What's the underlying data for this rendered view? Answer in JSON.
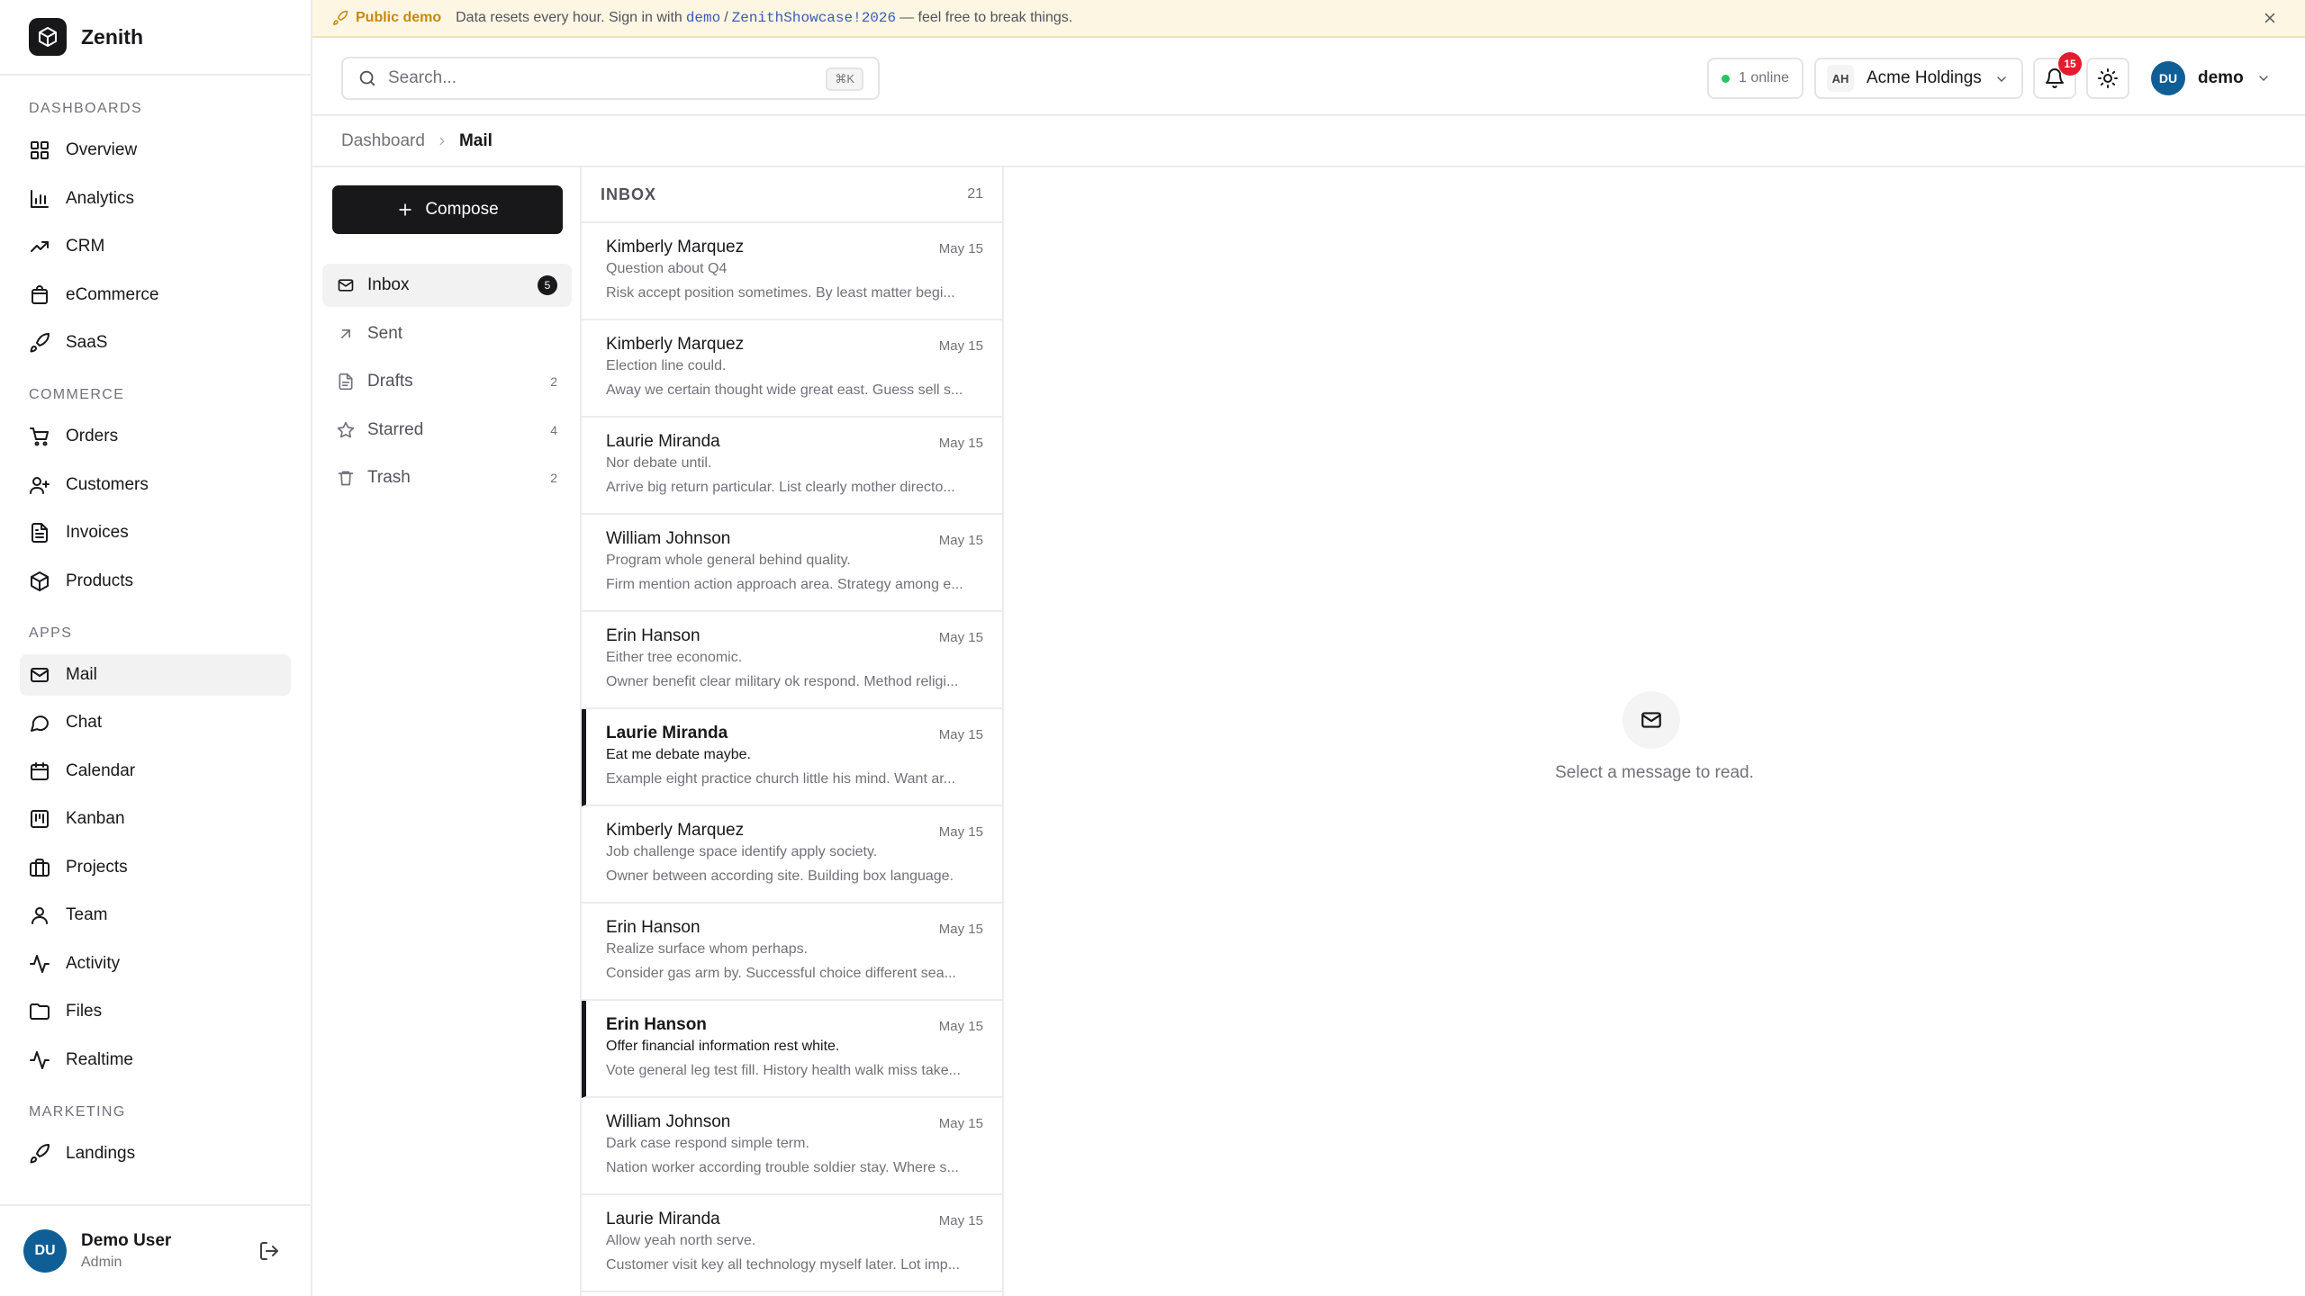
{
  "app": {
    "name": "Zenith"
  },
  "banner": {
    "tag": "Public demo",
    "text_before": "Data resets every hour. Sign in with",
    "username": "demo",
    "separator": "/",
    "password": "ZenithShowcase!2026",
    "text_after": "— feel free to break things."
  },
  "sidebar": {
    "sections": [
      {
        "title": "DASHBOARDS",
        "items": [
          {
            "label": "Overview",
            "icon": "grid-icon"
          },
          {
            "label": "Analytics",
            "icon": "bar-chart-icon"
          },
          {
            "label": "CRM",
            "icon": "trending-up-icon"
          },
          {
            "label": "eCommerce",
            "icon": "shopping-bag-icon"
          },
          {
            "label": "SaaS",
            "icon": "rocket-icon"
          }
        ]
      },
      {
        "title": "COMMERCE",
        "items": [
          {
            "label": "Orders",
            "icon": "cart-icon"
          },
          {
            "label": "Customers",
            "icon": "user-plus-icon"
          },
          {
            "label": "Invoices",
            "icon": "file-text-icon"
          },
          {
            "label": "Products",
            "icon": "box-icon"
          }
        ]
      },
      {
        "title": "APPS",
        "items": [
          {
            "label": "Mail",
            "icon": "mail-icon",
            "active": true
          },
          {
            "label": "Chat",
            "icon": "chat-icon"
          },
          {
            "label": "Calendar",
            "icon": "calendar-icon"
          },
          {
            "label": "Kanban",
            "icon": "kanban-icon"
          },
          {
            "label": "Projects",
            "icon": "briefcase-icon"
          },
          {
            "label": "Team",
            "icon": "user-icon"
          },
          {
            "label": "Activity",
            "icon": "activity-icon"
          },
          {
            "label": "Files",
            "icon": "folder-icon"
          },
          {
            "label": "Realtime",
            "icon": "pulse-icon"
          }
        ]
      },
      {
        "title": "MARKETING",
        "items": [
          {
            "label": "Landings",
            "icon": "rocket-icon"
          }
        ]
      }
    ],
    "user": {
      "initials": "DU",
      "name": "Demo User",
      "role": "Admin"
    }
  },
  "header": {
    "search_placeholder": "Search...",
    "search_shortcut": "⌘K",
    "online": "1 online",
    "org": {
      "initials": "AH",
      "name": "Acme Holdings"
    },
    "notifications": "15",
    "user": {
      "initials": "DU",
      "name": "demo"
    },
    "colors": {
      "avatar": "#0f5f96",
      "badge": "#e11d2e",
      "online": "#22c55e"
    }
  },
  "breadcrumb": {
    "root": "Dashboard",
    "current": "Mail"
  },
  "mail": {
    "compose_label": "Compose",
    "folders": [
      {
        "label": "Inbox",
        "icon": "mail-icon",
        "count": "5",
        "active": true
      },
      {
        "label": "Sent",
        "icon": "arrow-up-right-icon",
        "count": ""
      },
      {
        "label": "Drafts",
        "icon": "file-icon",
        "count": "2"
      },
      {
        "label": "Starred",
        "icon": "star-icon",
        "count": "4"
      },
      {
        "label": "Trash",
        "icon": "trash-icon",
        "count": "2"
      }
    ],
    "list_title": "INBOX",
    "list_count": "21",
    "messages": [
      {
        "from": "Kimberly Marquez",
        "date": "May 15",
        "subject": "Question about Q4",
        "preview": "Risk accept position sometimes. By least matter begi...",
        "unread": false
      },
      {
        "from": "Kimberly Marquez",
        "date": "May 15",
        "subject": "Election line could.",
        "preview": "Away we certain thought wide great east. Guess sell s...",
        "unread": false
      },
      {
        "from": "Laurie Miranda",
        "date": "May 15",
        "subject": "Nor debate until.",
        "preview": "Arrive big return particular. List clearly mother directo...",
        "unread": false
      },
      {
        "from": "William Johnson",
        "date": "May 15",
        "subject": "Program whole general behind quality.",
        "preview": "Firm mention action approach area. Strategy among e...",
        "unread": false
      },
      {
        "from": "Erin Hanson",
        "date": "May 15",
        "subject": "Either tree economic.",
        "preview": "Owner benefit clear military ok respond. Method religi...",
        "unread": false
      },
      {
        "from": "Laurie Miranda",
        "date": "May 15",
        "subject": "Eat me debate maybe.",
        "preview": "Example eight practice church little his mind. Want ar...",
        "unread": true
      },
      {
        "from": "Kimberly Marquez",
        "date": "May 15",
        "subject": "Job challenge space identify apply society.",
        "preview": "Owner between according site. Building box language.",
        "unread": false
      },
      {
        "from": "Erin Hanson",
        "date": "May 15",
        "subject": "Realize surface whom perhaps.",
        "preview": "Consider gas arm by. Successful choice different sea...",
        "unread": false
      },
      {
        "from": "Erin Hanson",
        "date": "May 15",
        "subject": "Offer financial information rest white.",
        "preview": "Vote general leg test fill. History health walk miss take...",
        "unread": true
      },
      {
        "from": "William Johnson",
        "date": "May 15",
        "subject": "Dark case respond simple term.",
        "preview": "Nation worker according trouble soldier stay. Where s...",
        "unread": false
      },
      {
        "from": "Laurie Miranda",
        "date": "May 15",
        "subject": "Allow yeah north serve.",
        "preview": "Customer visit key all technology myself later. Lot imp...",
        "unread": false
      }
    ],
    "empty_text": "Select a message to read."
  }
}
